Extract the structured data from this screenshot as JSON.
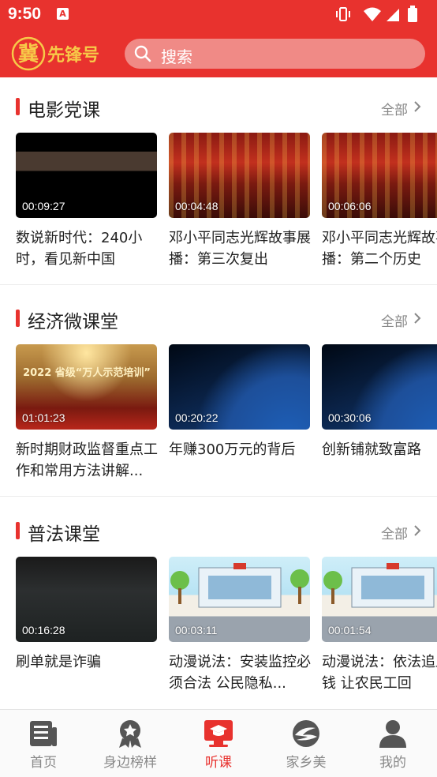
{
  "status_bar": {
    "time": "9:50",
    "notif_glyph": "A"
  },
  "header": {
    "logo_text": "冀先锋号",
    "search_placeholder": "搜索"
  },
  "sections": [
    {
      "title": "电影党课",
      "more_label": "全部",
      "cards": [
        {
          "duration": "00:09:27",
          "caption": "数说新时代：240小时，看见新中国",
          "thumb": "dark"
        },
        {
          "duration": "00:04:48",
          "caption": "邓小平同志光辉故事展播：第三次复出",
          "thumb": "hall"
        },
        {
          "duration": "00:06:06",
          "caption": "邓小平同志光辉故事展播：第二个历史",
          "thumb": "hall"
        }
      ]
    },
    {
      "title": "经济微课堂",
      "more_label": "全部",
      "cards": [
        {
          "duration": "01:01:23",
          "caption": "新时期财政监督重点工作和常用方法讲解...",
          "thumb": "gold",
          "overlay": "2022 省级“万人示范培训”"
        },
        {
          "duration": "00:20:22",
          "caption": "年赚300万元的背后",
          "thumb": "globe"
        },
        {
          "duration": "00:30:06",
          "caption": "创新铺就致富路",
          "thumb": "globe"
        }
      ]
    },
    {
      "title": "普法课堂",
      "more_label": "全部",
      "cards": [
        {
          "duration": "00:16:28",
          "caption": "刷单就是诈骗",
          "thumb": "night"
        },
        {
          "duration": "00:03:11",
          "caption": "动漫说法：安装监控必须合法 公民隐私...",
          "thumb": "cartoon"
        },
        {
          "duration": "00:01:54",
          "caption": "动漫说法：依法追血汗钱 让农民工回",
          "thumb": "cartoon"
        }
      ]
    }
  ],
  "bottom_nav": [
    {
      "label": "首页",
      "icon": "news-icon",
      "active": false
    },
    {
      "label": "身边榜样",
      "icon": "badge-star-icon",
      "active": false
    },
    {
      "label": "听课",
      "icon": "classroom-icon",
      "active": true
    },
    {
      "label": "家乡美",
      "icon": "landscape-logo-icon",
      "active": false
    },
    {
      "label": "我的",
      "icon": "person-icon",
      "active": false
    }
  ],
  "colors": {
    "brand_red": "#e8322e",
    "nav_inactive": "#888888"
  }
}
